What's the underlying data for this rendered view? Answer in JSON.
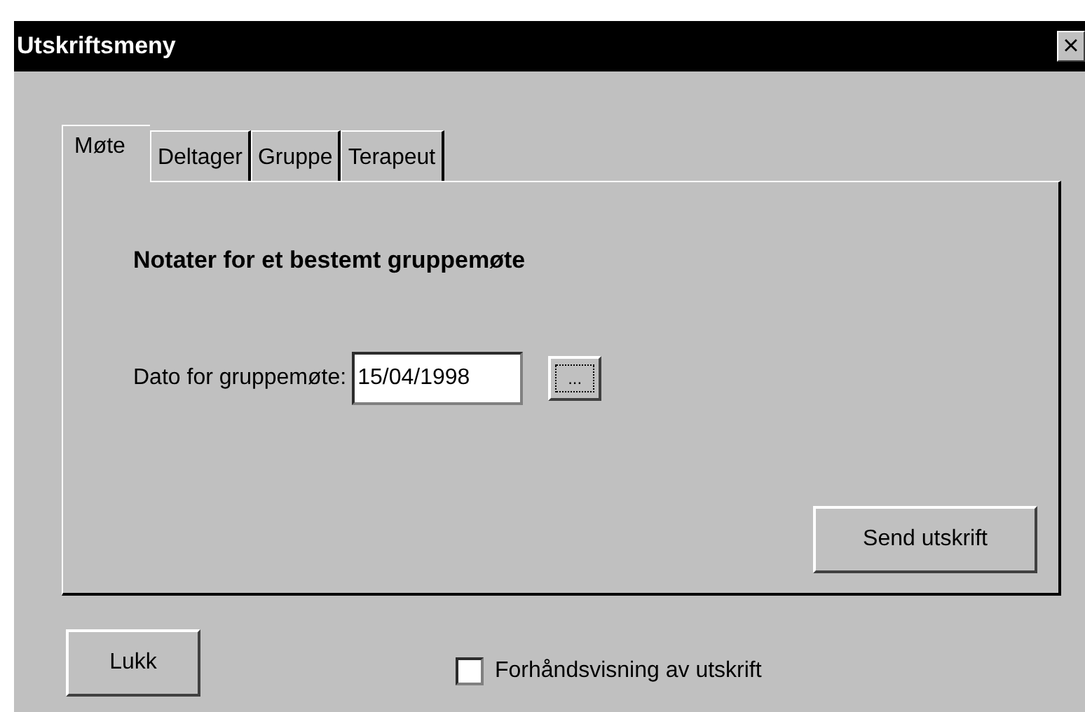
{
  "window": {
    "title": "Utskriftsmeny",
    "close": "×"
  },
  "tabs": [
    {
      "label": "Møte",
      "selected": true
    },
    {
      "label": "Deltager",
      "selected": false
    },
    {
      "label": "Gruppe",
      "selected": false
    },
    {
      "label": "Terapeut",
      "selected": false
    }
  ],
  "panel": {
    "heading": "Notater for et bestemt gruppemøte",
    "date_label": "Dato for gruppemøte:",
    "date_value": "15/04/1998",
    "picker_button": "...",
    "send_button": "Send utskrift"
  },
  "close_button": "Lukk",
  "preview": {
    "label": "Forhåndsvisning av utskrift",
    "checked": false
  }
}
